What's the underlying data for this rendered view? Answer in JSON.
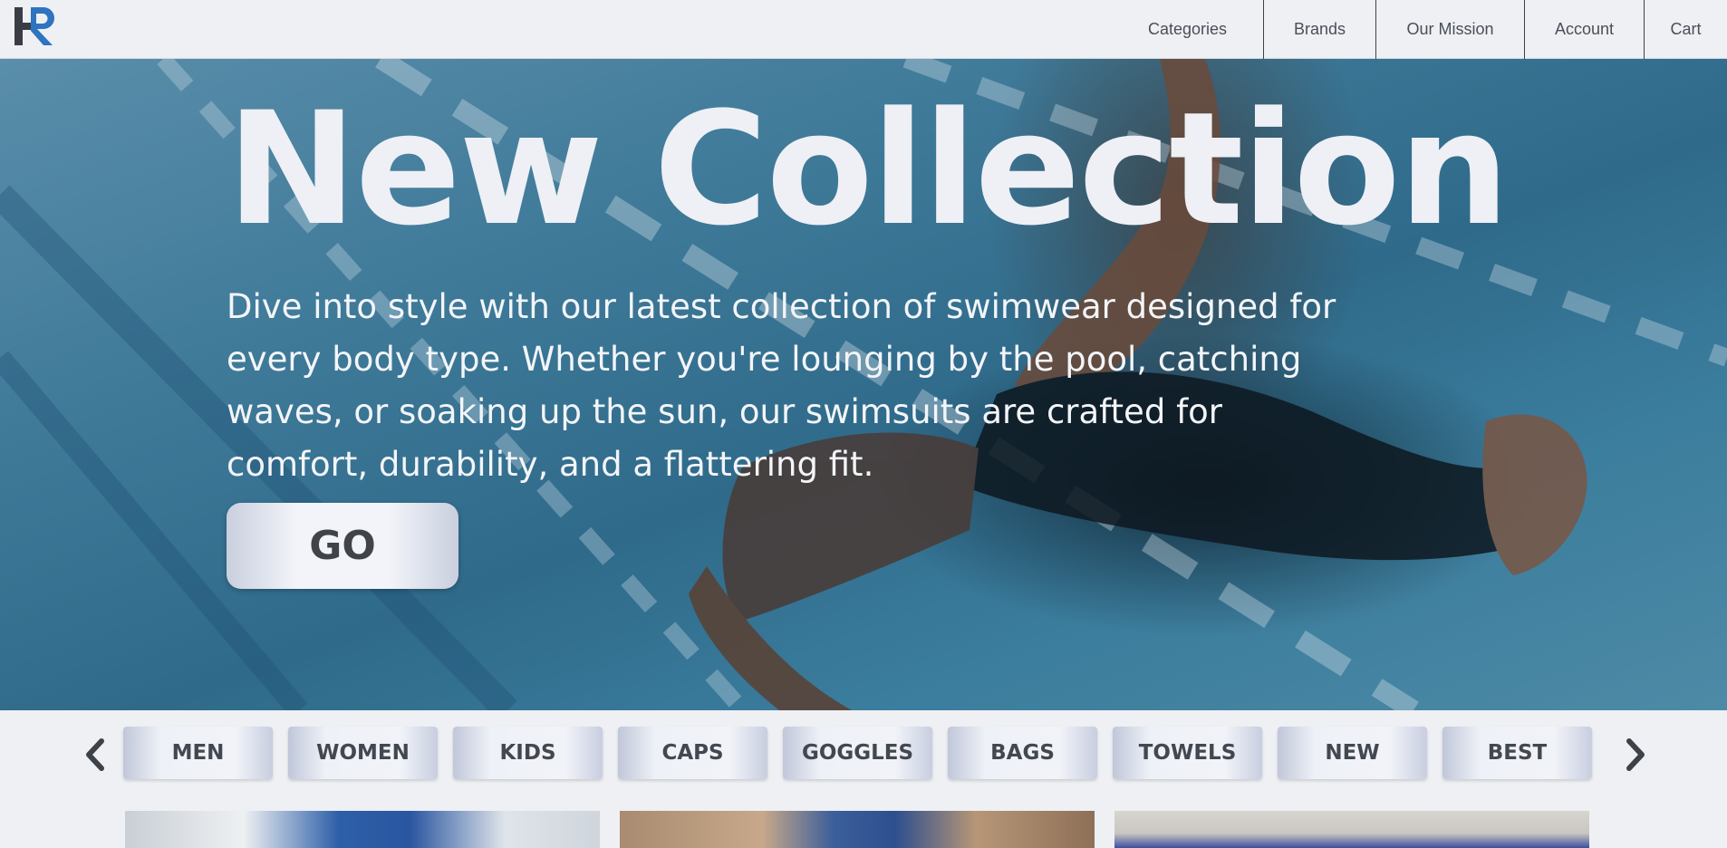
{
  "header": {
    "logo_text": "R",
    "nav": [
      {
        "label": "Categories"
      },
      {
        "label": "Brands"
      },
      {
        "label": "Our Mission"
      },
      {
        "label": "Account"
      },
      {
        "label": "Cart"
      }
    ]
  },
  "hero": {
    "title": "New Collection",
    "description": "Dive into style with our latest collection of swimwear designed for every body type. Whether you're lounging by the pool, catching waves, or soaking up the sun, our swimsuits are crafted for comfort, durability, and a flattering fit.",
    "cta_label": "GO"
  },
  "categories": {
    "prev_icon": "chevron-left-icon",
    "next_icon": "chevron-right-icon",
    "items": [
      {
        "label": "MEN"
      },
      {
        "label": "WOMEN"
      },
      {
        "label": "KIDS"
      },
      {
        "label": "CAPS"
      },
      {
        "label": "GOGGLES"
      },
      {
        "label": "BAGS"
      },
      {
        "label": "TOWELS"
      },
      {
        "label": "NEW"
      },
      {
        "label": "BEST"
      }
    ]
  },
  "colors": {
    "background": "#eef0f4",
    "text_dark": "#434850",
    "logo_dark": "#3a3d44",
    "logo_accent": "#2f74c0"
  }
}
